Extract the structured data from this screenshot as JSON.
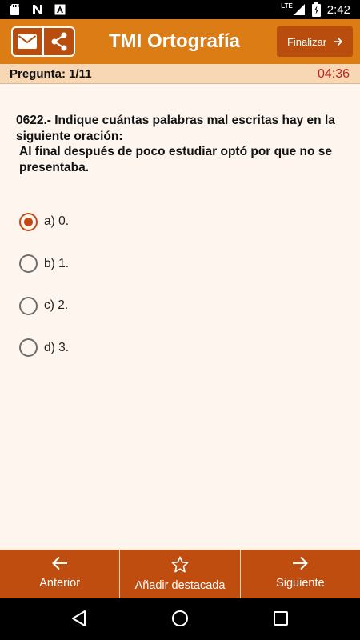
{
  "status_bar": {
    "time": "2:42",
    "network": "LTE"
  },
  "header": {
    "title": "TMI Ortografía",
    "finish_label": "Finalizar"
  },
  "info": {
    "counter": "Pregunta: 1/11",
    "timer": "04:36"
  },
  "question": {
    "text": "0622.- Indique cuántas palabras mal escritas hay en la siguiente oración:",
    "sentence": "Al final después de poco estudiar optó por que no se presentaba."
  },
  "options": [
    {
      "label": "a) 0.",
      "selected": true
    },
    {
      "label": "b) 1.",
      "selected": false
    },
    {
      "label": "c) 2.",
      "selected": false
    },
    {
      "label": "d) 3.",
      "selected": false
    }
  ],
  "bottom_nav": {
    "prev_label": "Anterior",
    "star_label": "Añadir destacada",
    "next_label": "Siguiente"
  },
  "colors": {
    "app_bar": "#dc7c14",
    "accent_dark": "#b84d0e",
    "bottom_bar": "#c04d10",
    "info_bar": "#f8d7b5",
    "timer": "#c0241c",
    "background": "#fdf5ee"
  },
  "icons": [
    "sd-card-icon",
    "n-logo-icon",
    "a-notification-icon",
    "lte-icon",
    "signal-icon",
    "battery-charging-icon",
    "mail-icon",
    "share-icon",
    "arrow-right-icon",
    "arrow-left-icon",
    "star-icon",
    "back-icon",
    "home-icon",
    "recents-icon"
  ]
}
